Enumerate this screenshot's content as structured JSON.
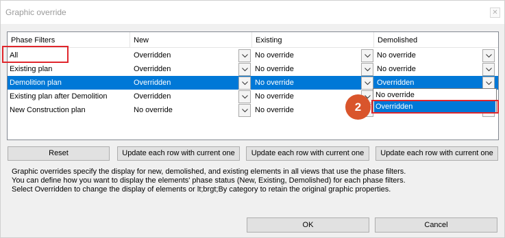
{
  "window": {
    "title": "Graphic override",
    "close_glyph": "✕"
  },
  "columns": [
    "Phase Filters",
    "New",
    "Existing",
    "Demolished"
  ],
  "rows": [
    {
      "phase": "All",
      "new": "Overridden",
      "existing": "No override",
      "demolished": "No override"
    },
    {
      "phase": "Existing plan",
      "new": "Overridden",
      "existing": "No override",
      "demolished": "No override"
    },
    {
      "phase": "Demolition plan",
      "new": "Overridden",
      "existing": "No override",
      "demolished": "Overridden"
    },
    {
      "phase": "Existing plan after Demolition",
      "new": "Overridden",
      "existing": "No override",
      "demolished": ""
    },
    {
      "phase": "New Construction plan",
      "new": "No override",
      "existing": "No override",
      "demolished": ""
    }
  ],
  "selected_row_index": 2,
  "dropdown_popup": {
    "options": [
      "No override",
      "Overridden"
    ],
    "highlighted": "Overridden"
  },
  "callout_badge": "2",
  "buttons": {
    "reset": "Reset",
    "update_new": "Update each row with current one",
    "update_existing": "Update each row with current one",
    "update_demolished": "Update each row with current one",
    "ok": "OK",
    "cancel": "Cancel"
  },
  "description": [
    "Graphic overrides specify the display for new, demolished, and existing elements in all views that use the phase filters.",
    "You can define how you want to display the elements' phase status (New, Existing, Demolished) for each phase filters.",
    "Select Overridden to change the display of elements or lt;brgt;By category to retain the original graphic properties."
  ],
  "colors": {
    "selection": "#0078d7",
    "highlight_box": "#e0252b",
    "badge": "#d9552c"
  }
}
